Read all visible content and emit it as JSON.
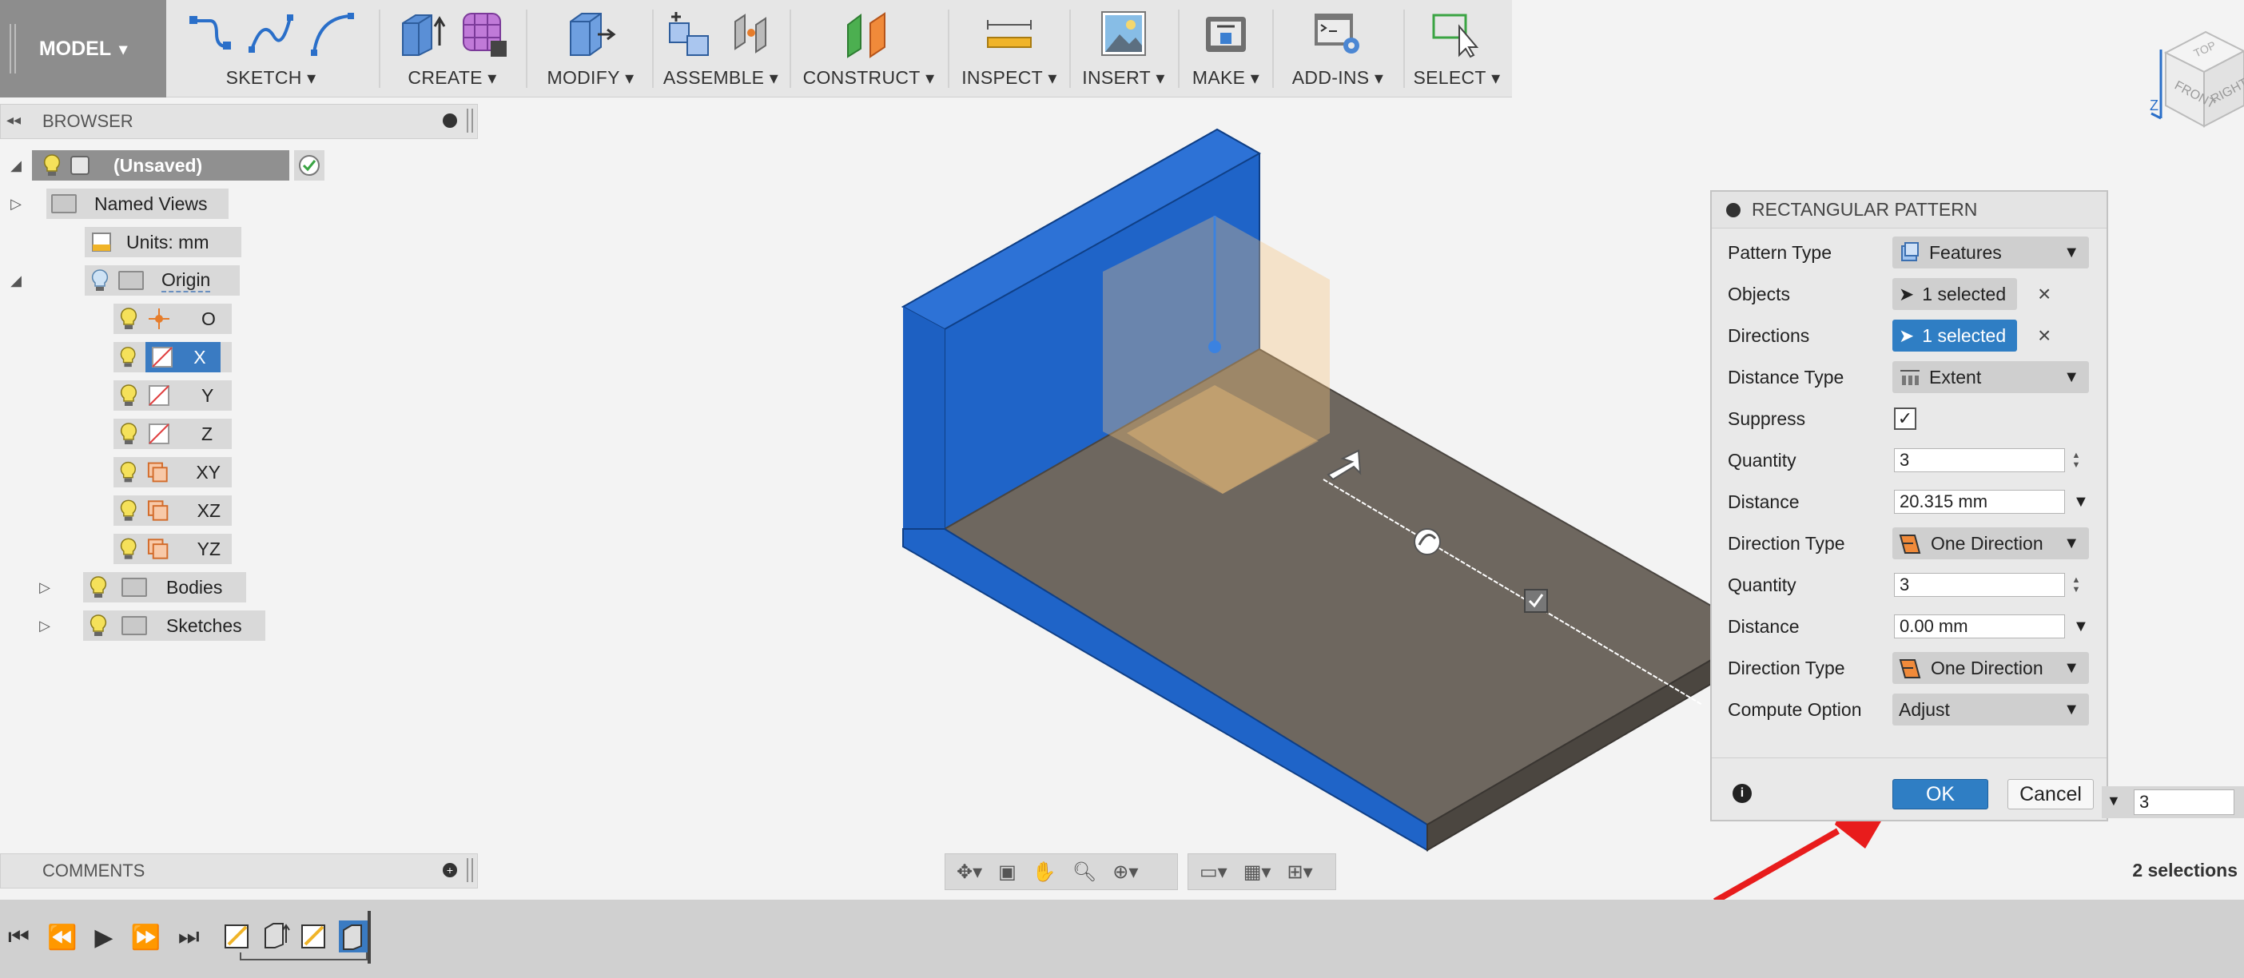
{
  "toolbar": {
    "model_label": "MODEL",
    "groups": [
      {
        "label": "SKETCH"
      },
      {
        "label": "CREATE"
      },
      {
        "label": "MODIFY"
      },
      {
        "label": "ASSEMBLE"
      },
      {
        "label": "CONSTRUCT"
      },
      {
        "label": "INSPECT"
      },
      {
        "label": "INSERT"
      },
      {
        "label": "MAKE"
      },
      {
        "label": "ADD-INS"
      },
      {
        "label": "SELECT"
      }
    ]
  },
  "browser": {
    "title": "BROWSER",
    "root": "(Unsaved)",
    "items": [
      {
        "label": "Named Views"
      },
      {
        "label": "Units: mm"
      },
      {
        "label": "Origin"
      },
      {
        "label": "O"
      },
      {
        "label": "X"
      },
      {
        "label": "Y"
      },
      {
        "label": "Z"
      },
      {
        "label": "XY"
      },
      {
        "label": "XZ"
      },
      {
        "label": "YZ"
      },
      {
        "label": "Bodies"
      },
      {
        "label": "Sketches"
      }
    ]
  },
  "comments": {
    "title": "COMMENTS"
  },
  "viewcube": {
    "top": "TOP",
    "front": "FRONT",
    "right": "RIGHT",
    "axis_z": "Z"
  },
  "dialog": {
    "title": "RECTANGULAR PATTERN",
    "rows": [
      {
        "label": "Pattern Type",
        "value": "Features"
      },
      {
        "label": "Objects",
        "value": "1 selected"
      },
      {
        "label": "Directions",
        "value": "1 selected"
      },
      {
        "label": "Distance Type",
        "value": "Extent"
      },
      {
        "label": "Suppress",
        "value": "checked"
      },
      {
        "label": "Quantity",
        "value": "3"
      },
      {
        "label": "Distance",
        "value": "20.315 mm"
      },
      {
        "label": "Direction Type",
        "value": "One Direction"
      },
      {
        "label": "Quantity",
        "value": "3"
      },
      {
        "label": "Distance",
        "value": "0.00 mm"
      },
      {
        "label": "Direction Type",
        "value": "One Direction"
      },
      {
        "label": "Compute Option",
        "value": "Adjust"
      }
    ],
    "ok": "OK",
    "cancel": "Cancel"
  },
  "status": {
    "selections": "2 selections",
    "quantity_field": "3"
  },
  "colors": {
    "accent": "#2f7ec4",
    "body_blue": "#1f64c8",
    "arrow_red": "#e81c1c",
    "plane_orange": "#f5c27a"
  }
}
